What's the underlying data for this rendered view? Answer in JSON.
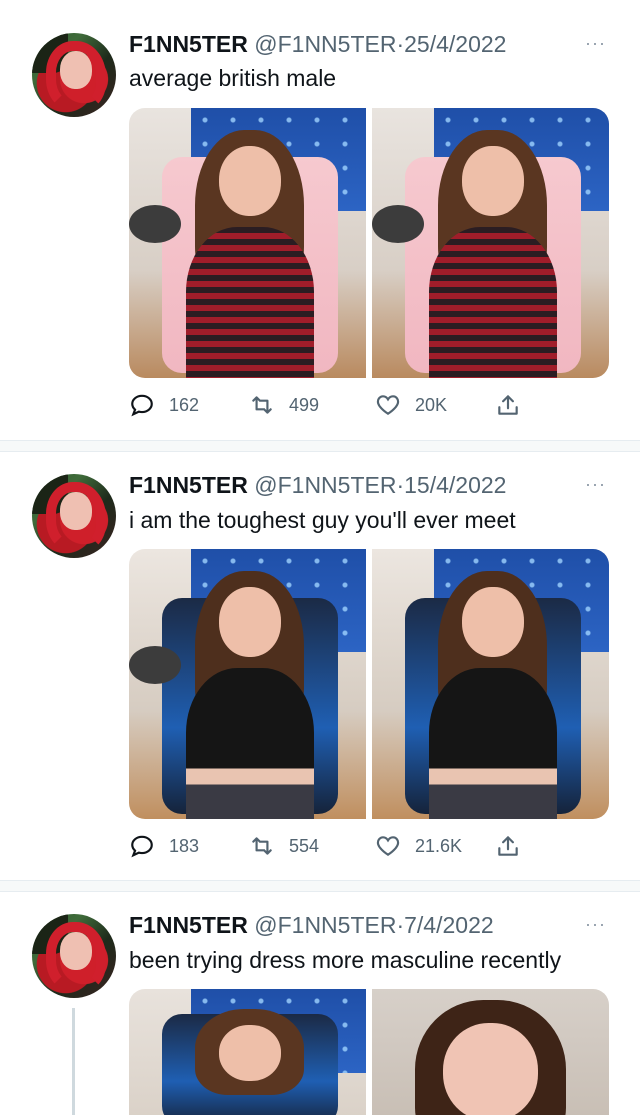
{
  "tweets": [
    {
      "name": "F1NN5TER",
      "handle": "@F1NN5TER",
      "dot": "·",
      "date": "25/4/2022",
      "more": "···",
      "text": "average british male",
      "replies": "162",
      "retweets": "499",
      "likes": "20K"
    },
    {
      "name": "F1NN5TER",
      "handle": "@F1NN5TER",
      "dot": "·",
      "date": "15/4/2022",
      "more": "···",
      "text": "i am the toughest guy you'll ever meet",
      "replies": "183",
      "retweets": "554",
      "likes": "21.6K"
    },
    {
      "name": "F1NN5TER",
      "handle": "@F1NN5TER",
      "dot": "·",
      "date": "7/4/2022",
      "more": "···",
      "text": "been trying dress more masculine recently"
    }
  ],
  "icons": {
    "reply": "reply-icon",
    "retweet": "retweet-icon",
    "like": "heart-icon",
    "share": "share-icon",
    "more": "more-icon"
  },
  "colors": {
    "text": "#0f1419",
    "muted": "#536471",
    "separator": "#f7f9f9",
    "banner": "#2c64c4",
    "hair_red": "#d01f2c"
  }
}
